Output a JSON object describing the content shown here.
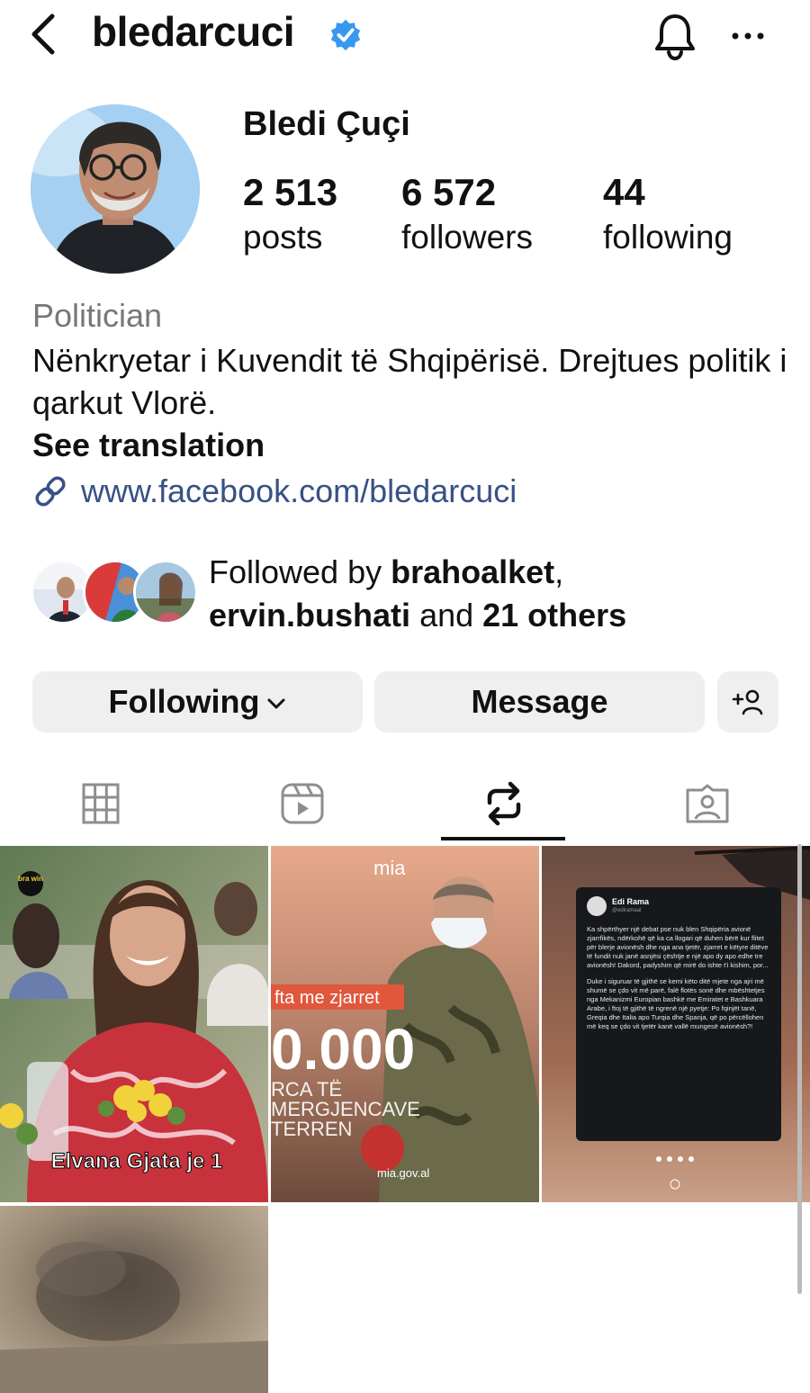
{
  "header": {
    "username": "bledarcuci"
  },
  "profile": {
    "display_name": "Bledi Çuçi",
    "stats": [
      {
        "value": "2 513",
        "label": "posts"
      },
      {
        "value": "6 572",
        "label": "followers"
      },
      {
        "value": "44",
        "label": "following"
      }
    ],
    "category": "Politician",
    "bio": "Nënkryetar i Kuvendit të Shqipërisë. Drejtues politik i qarkut Vlorë.",
    "see_translation": "See translation",
    "link": "www.facebook.com/bledarcuci"
  },
  "followed_by": {
    "prefix": "Followed by ",
    "user1": "brahoalket",
    "comma": ",",
    "user2": "ervin.bushati",
    "mid": " and ",
    "others": "21 others"
  },
  "actions": {
    "following_label": "Following",
    "message_label": "Message"
  },
  "tabs": [
    {
      "icon": "grid-icon",
      "active": false
    },
    {
      "icon": "reels-icon",
      "active": false
    },
    {
      "icon": "reposts-icon",
      "active": true
    },
    {
      "icon": "tagged-icon",
      "active": false
    }
  ],
  "grid": {
    "post1": {
      "badge": "bra win",
      "caption": "Elvana Gjata je 1"
    },
    "post2": {
      "logo": "mia",
      "banner": "fta me zjarret",
      "big_number": "0.000",
      "line1": "RCA TË",
      "line2": "MERGJENCAVE",
      "line3": "TERREN",
      "source": "mia.gov.al"
    },
    "post3": {
      "tweet_name": "Edi Rama",
      "tweet_handle": "@ediramaal",
      "tweet_p1": "Ka shpërthyer një debat pse nuk blen Shqipëria avionë zjarrfikës, ndërkohë që ka ca llogari që duhen bërë kur flitet për blerje avionësh dhe nga ana tjetër, zjarret e këtyre ditëve të fundit nuk janë asnjësi çështje e një apo dy apo edhe tre avionësh! Dakord, padyshim që mirë do ishte t'i kishim, por...",
      "tweet_p2": "Duke i siguruar të gjithë se kemi këto ditë mjete nga ajri më shumë se çdo vit më parë, falë flotës sonë dhe mbështetjes nga Mekanizmi Europian bashkë me Emiratet e Bashkuara Arabe, i ftoj të gjithë të ngrenë një pyetje: Po fqinjët tanë, Greqia dhe Italia apo Turqia dhe Spanja, që po përcëllohen më keq se çdo vit tjetër kanë vallë mungesë avionësh?!"
    }
  },
  "colors": {
    "link": "#385185",
    "verified": "#3897f0",
    "button_bg": "#efefef",
    "muted": "#777777"
  }
}
